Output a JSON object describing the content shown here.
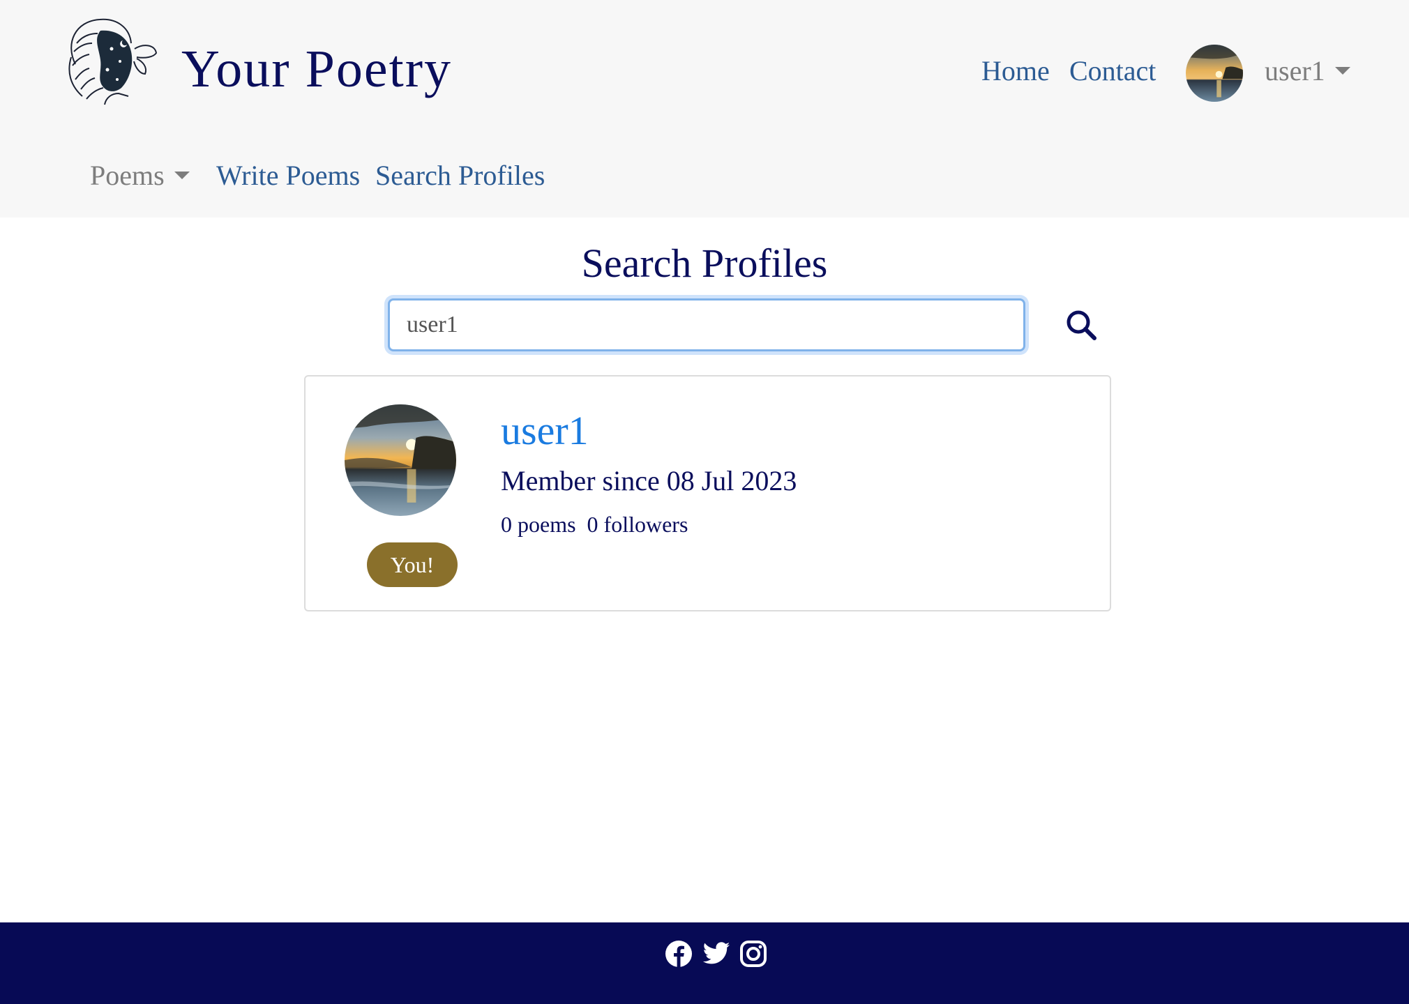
{
  "brand": {
    "title": "Your Poetry"
  },
  "nav": {
    "home": "Home",
    "contact": "Contact",
    "username": "user1",
    "poems": "Poems",
    "write_poems": "Write Poems",
    "search_profiles": "Search Profiles"
  },
  "main": {
    "heading": "Search Profiles",
    "search": {
      "value": "user1",
      "placeholder": ""
    }
  },
  "result": {
    "username": "user1",
    "member_since": "Member since 08 Jul 2023",
    "poems": "0 poems",
    "followers": "0 followers",
    "badge": "You!"
  },
  "icons": {
    "search": "search-icon",
    "facebook": "facebook-icon",
    "twitter": "twitter-icon",
    "instagram": "instagram-icon"
  },
  "colors": {
    "navy": "#0a0e5c",
    "link": "#2c5b93",
    "profile_link": "#1a7be0",
    "badge": "#8a702b",
    "footer": "#070a55",
    "navbar": "#f7f7f7"
  }
}
